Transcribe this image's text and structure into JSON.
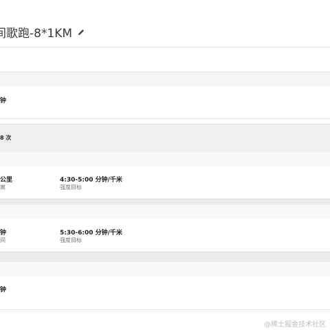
{
  "header": {
    "title": "间歌跑-8*1KM"
  },
  "steps": [
    {
      "duration": "钟"
    },
    {
      "repeat": "8 次"
    },
    {
      "distance": "公里",
      "distance_sub": "离",
      "target": "4:30-5:00 分钟/千米",
      "target_label": "强度目标"
    },
    {
      "duration": "钟",
      "duration_sub": "间",
      "target": "5:30-6:00 分钟/千米",
      "target_label": "强度目标"
    },
    {
      "duration": "钟"
    }
  ],
  "watermark": "@稀土掘金技术社区"
}
